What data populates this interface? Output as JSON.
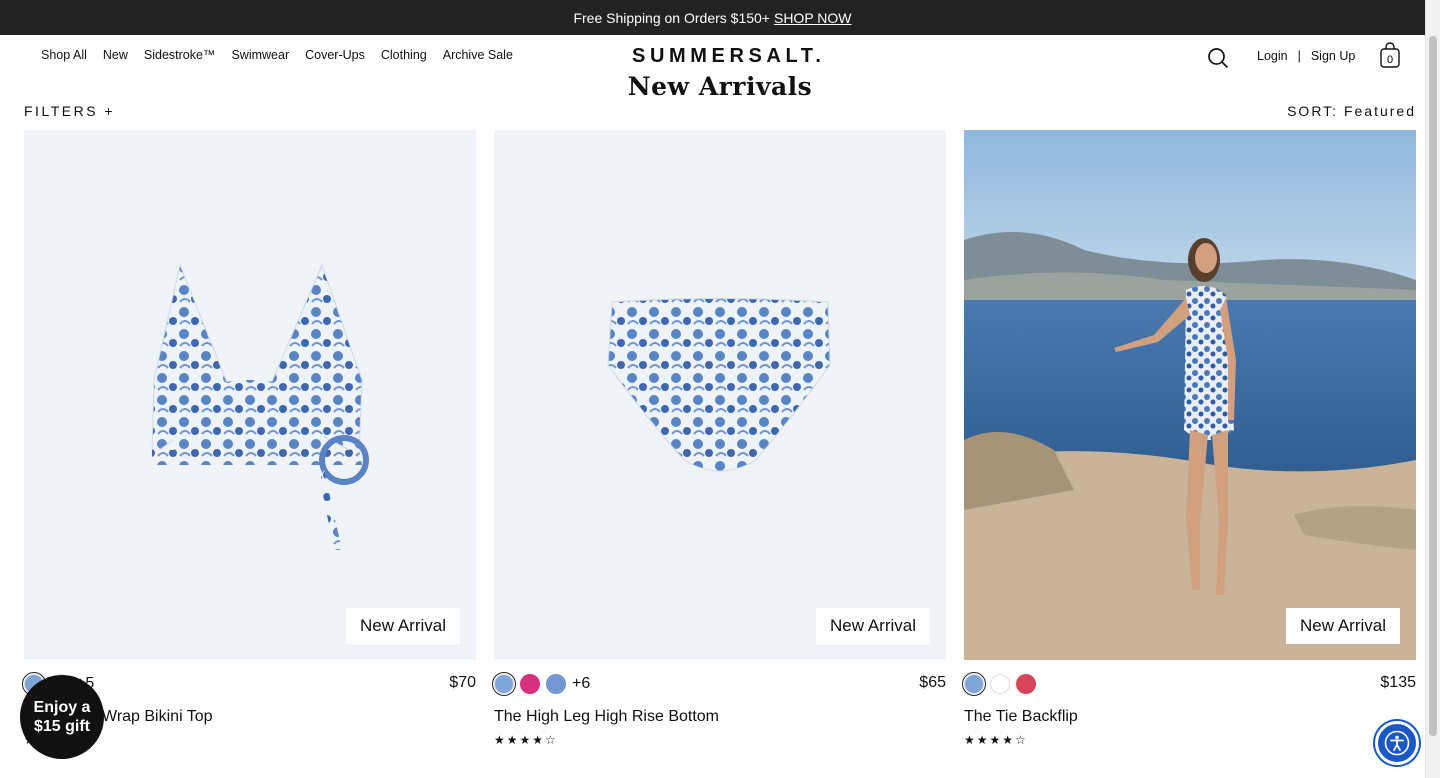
{
  "announcement": {
    "text": "Free Shipping on Orders $150+",
    "link": "SHOP NOW"
  },
  "nav": [
    "Shop All",
    "New",
    "Sidestroke™",
    "Swimwear",
    "Cover-Ups",
    "Clothing",
    "Archive Sale"
  ],
  "brand": "SUMMERSALT.",
  "page_title": "New Arrivals",
  "auth": {
    "login": "Login",
    "separator": "|",
    "signup": "Sign Up"
  },
  "cart_count": "0",
  "filters_label": "FILTERS +",
  "sort_label": "SORT: Featured",
  "products": [
    {
      "name": "Wrap Bikini Top",
      "price": "$70",
      "more_colors": "+5",
      "badge": "New Arrival",
      "rating_stars": "★★★★★",
      "swatch_colors": [
        "#7ea4d8",
        "#ffffff"
      ]
    },
    {
      "name": "The High Leg High Rise Bottom",
      "price": "$65",
      "more_colors": "+6",
      "badge": "New Arrival",
      "rating_stars": "★★★★☆",
      "swatch_colors": [
        "#7ea4d8",
        "#d6317d",
        "#7495d3"
      ]
    },
    {
      "name": "The Tie Backflip",
      "price": "$135",
      "more_colors": "",
      "badge": "New Arrival",
      "rating_stars": "★★★★☆",
      "swatch_colors": [
        "#7ea4d8",
        "#ffffff",
        "#d8455a"
      ]
    }
  ],
  "gift_badge": "Enjoy a $15 gift",
  "colors": {
    "accent_blue": "#1a58c7",
    "announce_bg": "#222222"
  }
}
